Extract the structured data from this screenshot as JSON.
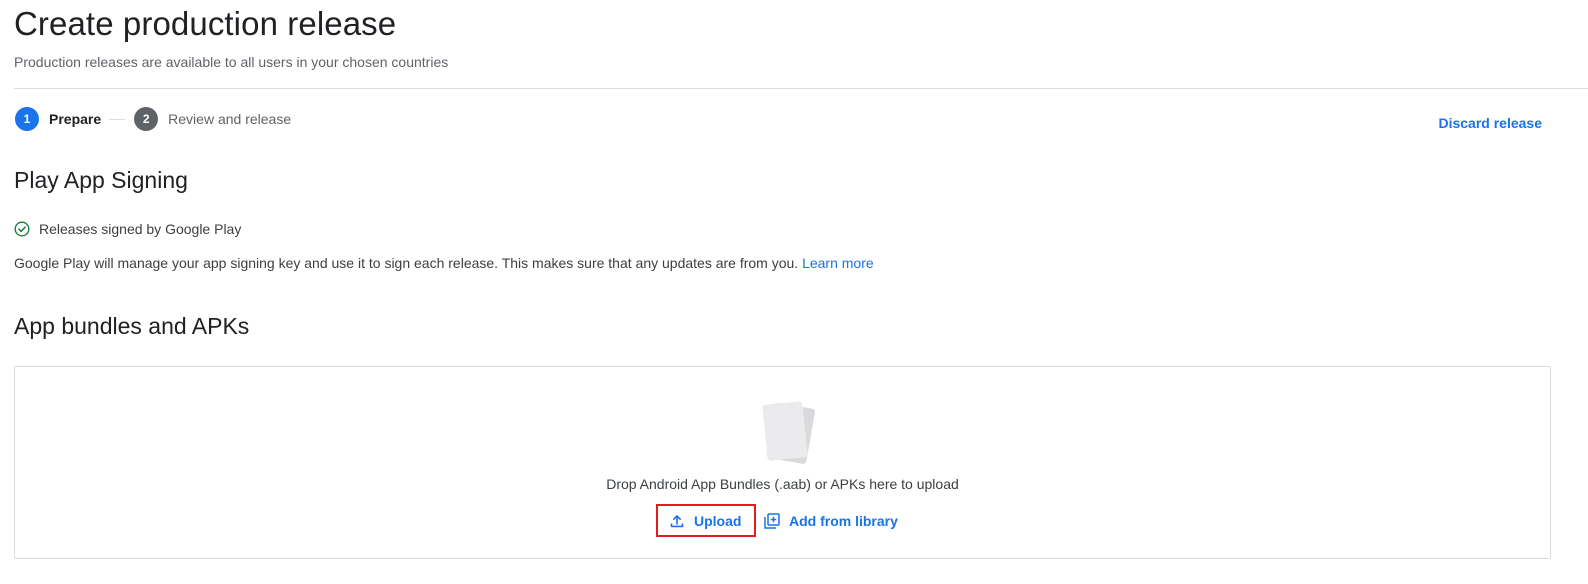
{
  "header": {
    "title": "Create production release",
    "subtitle": "Production releases are available to all users in your chosen countries"
  },
  "stepper": {
    "steps": [
      {
        "number": "1",
        "label": "Prepare",
        "state": "active"
      },
      {
        "number": "2",
        "label": "Review and release",
        "state": "inactive"
      }
    ]
  },
  "actions": {
    "discard_label": "Discard release"
  },
  "signing": {
    "heading": "Play App Signing",
    "status_text": "Releases signed by Google Play",
    "description": "Google Play will manage your app signing key and use it to sign each release. This makes sure that any updates are from you.",
    "learn_more": "Learn more"
  },
  "bundles": {
    "heading": "App bundles and APKs",
    "drop_text": "Drop Android App Bundles (.aab) or APKs here to upload",
    "upload_label": "Upload",
    "library_label": "Add from library"
  },
  "icons": {
    "status": "check-circle-icon",
    "upload": "upload-icon",
    "library": "library-add-icon",
    "illustration": "file-stack-icon"
  },
  "colors": {
    "accent": "#1a73e8",
    "success": "#188038",
    "highlight_border": "#e8191b",
    "step_inactive": "#5f6368"
  }
}
